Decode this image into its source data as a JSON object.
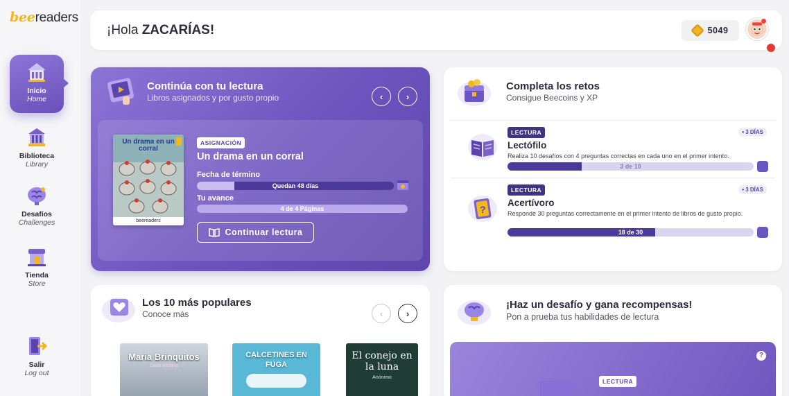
{
  "brand": {
    "logo_accent": "bee",
    "logo_rest": "readers"
  },
  "sidebar": {
    "items": [
      {
        "label": "Inicio",
        "sublabel": "Home",
        "icon": "home-icon",
        "active": true
      },
      {
        "label": "Biblioteca",
        "sublabel": "Library",
        "icon": "library-icon"
      },
      {
        "label": "Desafíos",
        "sublabel": "Challenges",
        "icon": "brain-icon"
      },
      {
        "label": "Tienda",
        "sublabel": "Store",
        "icon": "store-icon"
      },
      {
        "label": "Salir",
        "sublabel": "Log out",
        "icon": "logout-icon"
      }
    ]
  },
  "header": {
    "greeting": "¡Hola ",
    "username": "ZACARÍAS!",
    "coins": "5049"
  },
  "reading": {
    "title": "Continúa con tu lectura",
    "subtitle": "Libros asignados y por gusto propio",
    "prev": "‹",
    "next": "›",
    "tag": "ASIGNACIÓN",
    "book_title": "Un drama en un corral",
    "cover_title": "Un drama en un corral",
    "cover_brand": "beereaders",
    "due_label": "Fecha de término",
    "due_text": "Quedan 48 días",
    "due_progress": 0.19,
    "progress_label": "Tu avance",
    "progress_text": "4 de 4 Páginas",
    "progress_value": 1.0,
    "button": "Continuar lectura"
  },
  "challenges": {
    "title": "Completa los retos",
    "subtitle": "Consigue Beecoins y XP",
    "items": [
      {
        "tag": "LECTURA",
        "days": "3 DÍAS",
        "name": "Lectófilo",
        "desc": "Realiza 10 desafíos con 4 preguntas correctas en cada uno en el primer intento.",
        "progress_text": "3 de 10",
        "progress": 0.3
      },
      {
        "tag": "LECTURA",
        "days": "3 DÍAS",
        "name": "Acertívoro",
        "desc": "Responde 30 preguntas correctamente en el primer intento de libros de gusto propio.",
        "progress_text": "18 de 30",
        "progress": 0.6
      }
    ]
  },
  "popular": {
    "title": "Los 10 más populares",
    "subtitle": "Conoce más",
    "prev": "‹",
    "next": "›",
    "books": [
      "Maria Brinquitos",
      "CALCETINES EN FUGA",
      "El conejo en la luna"
    ],
    "book_authors": [
      "Dalia Medina",
      "",
      "Anónimo"
    ]
  },
  "desafio": {
    "title": "¡Haz un desafío y gana recompensas!",
    "subtitle": "Pon a prueba tus habilidades de lectura",
    "tag": "LECTURA",
    "help": "?"
  },
  "colors": {
    "accent": "#6c53bd",
    "coin": "#f0b323",
    "notif": "#e9453d"
  }
}
